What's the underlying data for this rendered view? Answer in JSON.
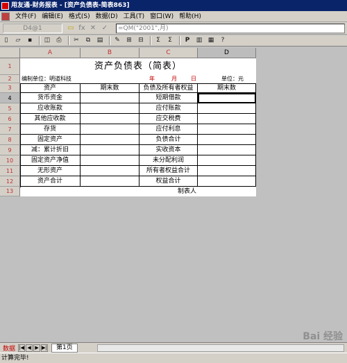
{
  "window": {
    "title": "用友通-财务报表 - [资产负债表-简表863]"
  },
  "menu": [
    "文件(F)",
    "编辑(E)",
    "格式(S)",
    "数据(D)",
    "工具(T)",
    "窗口(W)",
    "帮助(H)"
  ],
  "formula_bar": {
    "cell_ref": "D4@1",
    "fx_icon": "fx",
    "cancel_icon": "✕",
    "confirm_icon": "✓",
    "formula": "=QM(\"2001\",月)"
  },
  "toolbar": [
    "new-icon",
    "open-icon",
    "save-icon",
    "preview-icon",
    "print-icon",
    "cut-icon",
    "copy-icon",
    "paste-icon",
    "format-brush-icon",
    "insert-icon",
    "delete-icon",
    "sum-icon",
    "sigma-icon",
    "p-icon",
    "page-icon",
    "chart-icon",
    "help-icon"
  ],
  "columns": [
    "A",
    "B",
    "C",
    "D"
  ],
  "rows": [
    "1",
    "2",
    "3",
    "4",
    "5",
    "6",
    "7",
    "8",
    "9",
    "10",
    "11",
    "12",
    "13"
  ],
  "report": {
    "title": "资产负债表（简表）",
    "unit_left": "编制单位：明道科技",
    "year": "年",
    "month": "月",
    "day": "日",
    "unit_right": "单位：元",
    "headers": [
      "资产",
      "期末数",
      "负债及所有者权益",
      "期末数"
    ],
    "assets": [
      "货币资金",
      "应收账款",
      "其他应收款",
      "存货",
      "固定资产",
      "减：累计折旧",
      "固定资产净值",
      "无形资产",
      "资产合计"
    ],
    "liabilities": [
      "短期借款",
      "应付账款",
      "应交税费",
      "应付利息",
      "负债合计",
      "实收资本",
      "未分配利润",
      "所有者权益合计",
      "权益合计"
    ],
    "preparer": "制表人"
  },
  "tabs": {
    "data_label": "数据",
    "sheet_name": "第1页"
  },
  "status": "计算完毕!",
  "watermark": "Bai 经验"
}
